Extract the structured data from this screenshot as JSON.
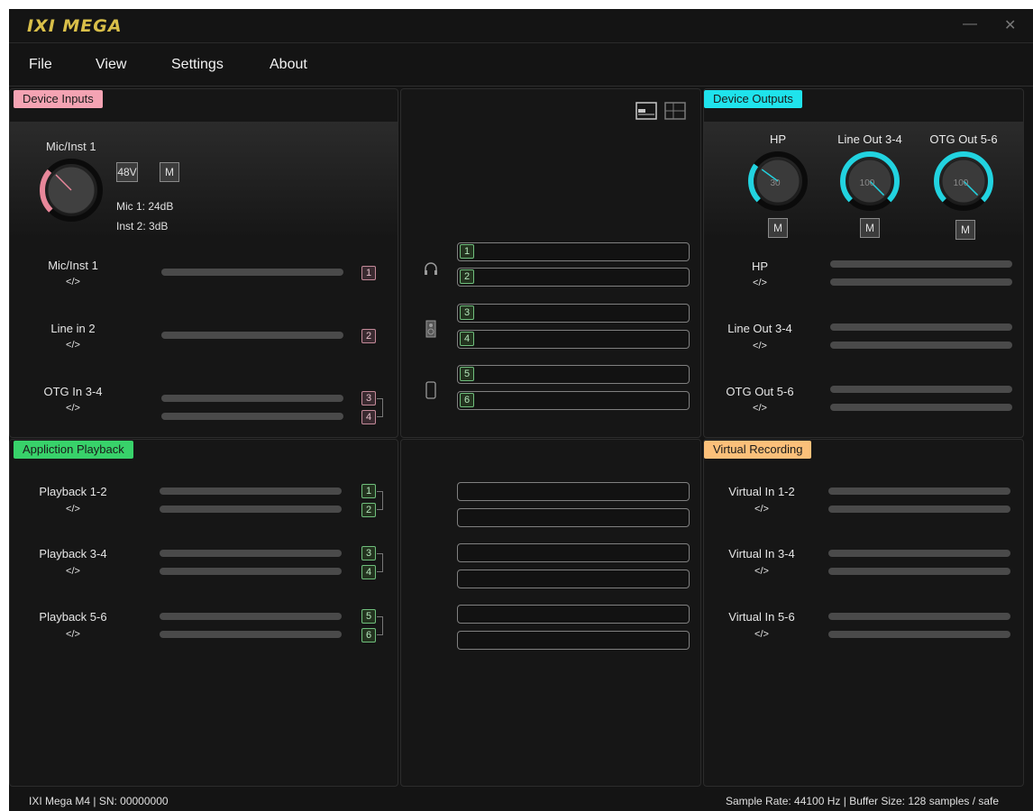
{
  "app": {
    "logo": "IXI MEGA",
    "minimize_glyph": "—",
    "close_glyph": "✕"
  },
  "menu": [
    "File",
    "View",
    "Settings",
    "About"
  ],
  "device_inputs": {
    "tag": "Device Inputs",
    "preamp": {
      "title": "Mic/Inst 1",
      "phantom_label": "48V",
      "mute_label": "M",
      "mic_gain": "Mic 1: 24dB",
      "inst_gain": "Inst 2: 3dB",
      "accent": "#e8879a"
    },
    "channels": [
      {
        "name": "Mic/Inst 1",
        "code": "</>",
        "badges": [
          "1"
        ]
      },
      {
        "name": "Line in 2",
        "code": "</>",
        "badges": [
          "2"
        ]
      },
      {
        "name": "OTG In 3-4",
        "code": "</>",
        "badges": [
          "3",
          "4"
        ]
      }
    ]
  },
  "routing": {
    "view_icons": [
      "layout-single-icon",
      "layout-split-icon"
    ],
    "top_groups": [
      {
        "icon": "headphones-icon",
        "slots": [
          "1",
          "2"
        ]
      },
      {
        "icon": "speaker-icon",
        "slots": [
          "3",
          "4"
        ]
      },
      {
        "icon": "phone-icon",
        "slots": [
          "5",
          "6"
        ]
      }
    ]
  },
  "device_outputs": {
    "tag": "Device Outputs",
    "knobs": [
      {
        "label": "HP",
        "value": "30",
        "level": 0.3,
        "mute": "M"
      },
      {
        "label": "Line Out 3-4",
        "value": "100",
        "level": 1.0,
        "mute": "M"
      },
      {
        "label": "OTG Out 5-6",
        "value": "100",
        "level": 1.0,
        "mute": "M"
      }
    ],
    "accent": "#22d3e0",
    "channels": [
      {
        "name": "HP",
        "code": "</>"
      },
      {
        "name": "Line Out 3-4",
        "code": "</>"
      },
      {
        "name": "OTG Out 5-6",
        "code": "</>"
      }
    ]
  },
  "application_playback": {
    "tag": "Appliction Playback",
    "channels": [
      {
        "name": "Playback 1-2",
        "code": "</>",
        "badges": [
          "1",
          "2"
        ]
      },
      {
        "name": "Playback 3-4",
        "code": "</>",
        "badges": [
          "3",
          "4"
        ]
      },
      {
        "name": "Playback 5-6",
        "code": "</>",
        "badges": [
          "5",
          "6"
        ]
      }
    ]
  },
  "virtual_recording": {
    "tag": "Virtual Recording",
    "channels": [
      {
        "name": "Virtual In 1-2",
        "code": "</>"
      },
      {
        "name": "Virtual In 3-4",
        "code": "</>"
      },
      {
        "name": "Virtual In 5-6",
        "code": "</>"
      }
    ]
  },
  "status": {
    "device": "IXI Mega M4  |  SN: 00000000",
    "right": "Sample Rate: 44100 Hz |   Buffer Size: 128 samples / safe"
  },
  "colors": {
    "inputs_tag": "#f4a3b3",
    "outputs_tag": "#1fe3ec",
    "playback_tag": "#38d26a",
    "virtual_tag": "#fbc07a",
    "logo": "#d9bf49"
  }
}
